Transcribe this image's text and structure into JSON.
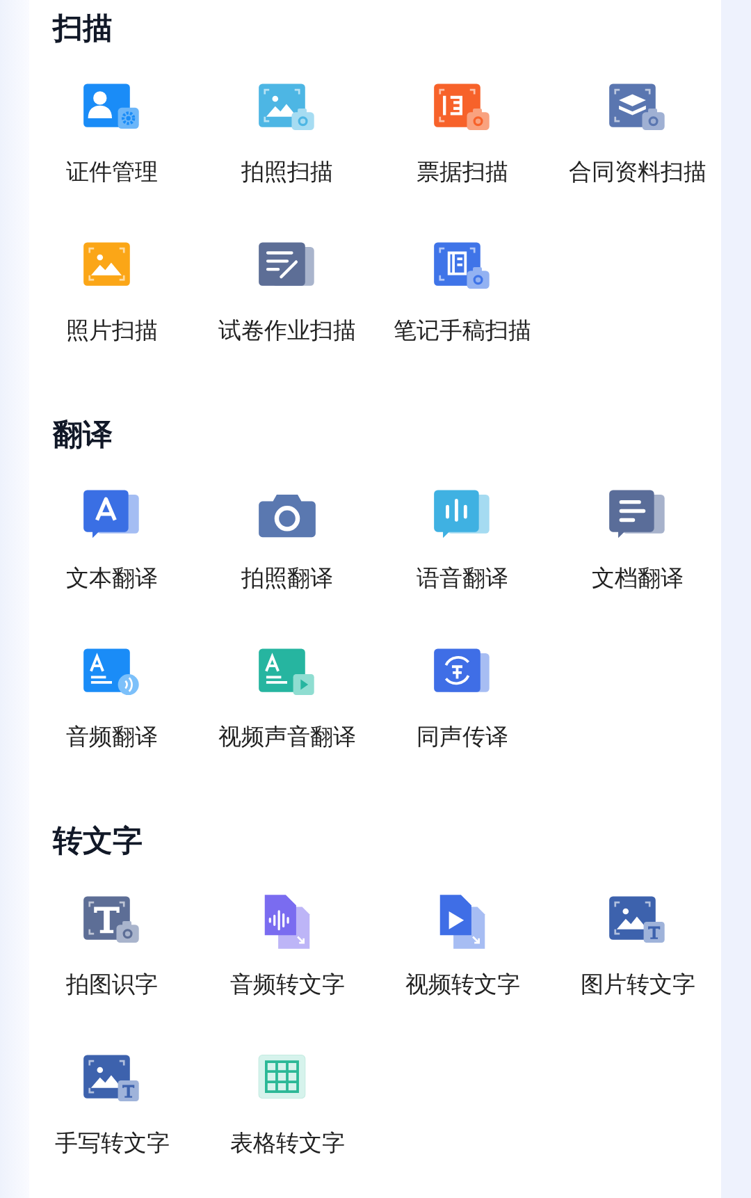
{
  "sections": [
    {
      "title": "扫描",
      "items": [
        {
          "label": "证件管理"
        },
        {
          "label": "拍照扫描"
        },
        {
          "label": "票据扫描"
        },
        {
          "label": "合同资料扫描"
        },
        {
          "label": "照片扫描"
        },
        {
          "label": "试卷作业扫描"
        },
        {
          "label": "笔记手稿扫描"
        }
      ]
    },
    {
      "title": "翻译",
      "items": [
        {
          "label": "文本翻译"
        },
        {
          "label": "拍照翻译"
        },
        {
          "label": "语音翻译"
        },
        {
          "label": "文档翻译"
        },
        {
          "label": "音频翻译"
        },
        {
          "label": "视频声音翻译"
        },
        {
          "label": "同声传译"
        }
      ]
    },
    {
      "title": "转文字",
      "items": [
        {
          "label": "拍图识字"
        },
        {
          "label": "音频转文字"
        },
        {
          "label": "视频转文字"
        },
        {
          "label": "图片转文字"
        },
        {
          "label": "手写转文字"
        },
        {
          "label": "表格转文字"
        }
      ]
    }
  ]
}
